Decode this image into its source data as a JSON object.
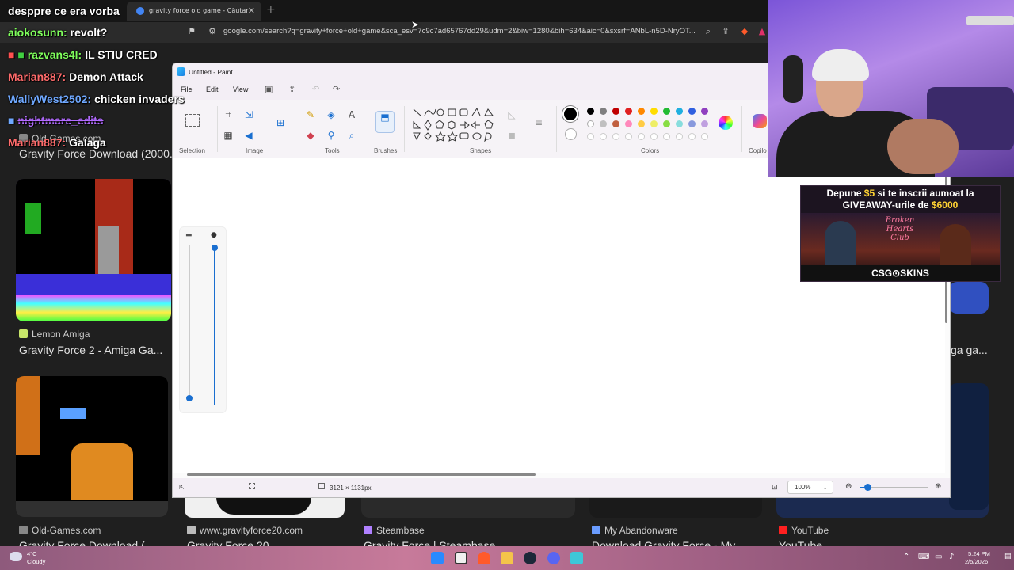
{
  "browser": {
    "tab_title": "gravity force old game - Căutar",
    "url": "google.com/search?q=gravity+force+old+game&sca_esv=7c9c7ad65767dd29&udm=2&biw=1280&bih=634&aic=0&sxsrf=ANbL-n5D-NryOT...",
    "results": [
      {
        "source": "Lemon Amiga",
        "title": "Gravity Force 2 - Amiga Ga..."
      },
      {
        "source": "Old-Games.com",
        "title": "Gravity Force Download (2000..."
      },
      {
        "source": "Old-Games.com",
        "title": "Gravity Force Download (..."
      },
      {
        "source": "www.gravityforce20.com",
        "title": "Gravity Force 20..."
      },
      {
        "source": "Steambase",
        "title": "Gravity Force | Steambase..."
      },
      {
        "source": "My Abandonware",
        "title": "Download Gravity Force - My..."
      },
      {
        "source": "YouTube",
        "title": "YouTube"
      }
    ],
    "right_partial_title": "ga ga..."
  },
  "chat": {
    "header": "desppre ce era vorba",
    "messages": [
      {
        "user": "aiokosunn:",
        "text": "revolt?",
        "color": "#7fff5c"
      },
      {
        "user": "razvans4l:",
        "text": "IL STIU CRED",
        "color": "#7fff5c"
      },
      {
        "user": "Marian887:",
        "text": "Demon Attack",
        "color": "#ff6b6b"
      },
      {
        "user": "WallyWest2502:",
        "text": "chicken invaders",
        "color": "#6fa8ff"
      },
      {
        "user": "nightmare_edits",
        "text": "",
        "color": "#b36bff"
      },
      {
        "user": "Marian887:",
        "text": "Galaga",
        "color": "#ff6b6b"
      }
    ]
  },
  "paint": {
    "window_title": "Untitled - Paint",
    "menu": {
      "file": "File",
      "edit": "Edit",
      "view": "View"
    },
    "groups": {
      "selection": "Selection",
      "image": "Image",
      "tools": "Tools",
      "brushes": "Brushes",
      "shapes": "Shapes",
      "colors": "Colors",
      "copilot": "Copilo"
    },
    "status": {
      "dimensions": "3121 × 1131px",
      "zoom": "100%"
    },
    "palette_row1": [
      "#000000",
      "#808080",
      "#c00000",
      "#e02020",
      "#ff8800",
      "#ffdd00",
      "#22bb33",
      "#20b0e0",
      "#3060e0",
      "#9040c0"
    ],
    "palette_row2": [
      "#ffffff",
      "#c0c0c0",
      "#c06040",
      "#ff88bb",
      "#ffcc44",
      "#eeee66",
      "#88dd44",
      "#88dddd",
      "#8899dd",
      "#c0a0e0"
    ],
    "zoom_level": 0.1
  },
  "ad": {
    "line1_a": "Depune ",
    "line1_b": "$5",
    "line1_c": " si te inscrii aumoat la",
    "line2_a": "GIVEAWAY",
    "line2_b": "-urile de ",
    "line2_c": "$6000",
    "scene_text": "Broken Hearts Club",
    "footer": "CSG⊙SKINS"
  },
  "taskbar": {
    "weather_temp": "4°C",
    "weather_desc": "Cloudy",
    "time": "5:24 PM",
    "date": "2/5/2026"
  }
}
